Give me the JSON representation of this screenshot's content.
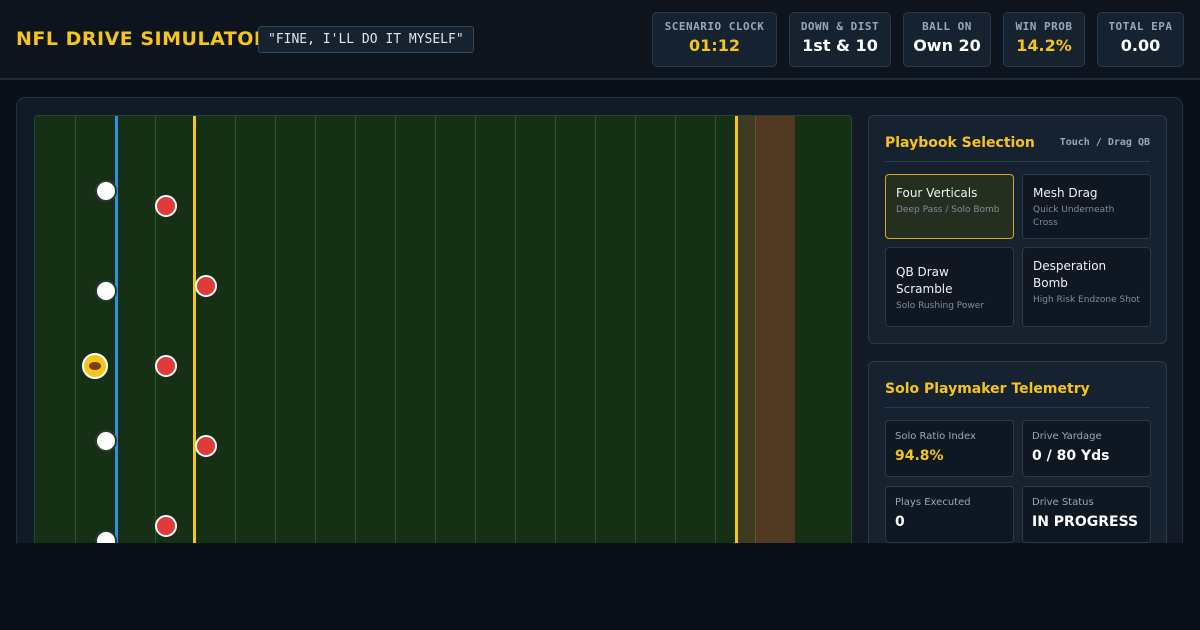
{
  "header": {
    "title": "NFL DRIVE SIMULATOR",
    "quote": "\"FINE, I'LL DO IT MYSELF\""
  },
  "stats": [
    {
      "label": "SCENARIO CLOCK",
      "value": "01:12",
      "accent": true
    },
    {
      "label": "DOWN & DIST",
      "value": "1st & 10",
      "accent": false
    },
    {
      "label": "BALL ON",
      "value": "Own 20",
      "accent": false
    },
    {
      "label": "WIN PROB",
      "value": "14.2%",
      "accent": true
    },
    {
      "label": "TOTAL EPA",
      "value": "0.00",
      "accent": false
    }
  ],
  "field": {
    "colors": {
      "turf": "#153014",
      "los": "#2f8fe0",
      "first_down": "#f5c518",
      "endzone": "#523a22",
      "offense": "#ffffff",
      "defense": "#e03a3a"
    }
  },
  "playbook": {
    "title": "Playbook Selection",
    "hint": "Touch / Drag QB",
    "plays": [
      {
        "name": "Four Verticals",
        "desc": "Deep Pass / Solo Bomb",
        "active": true
      },
      {
        "name": "Mesh Drag",
        "desc": "Quick Underneath Cross",
        "active": false
      },
      {
        "name": "QB Draw Scramble",
        "desc": "Solo Rushing Power",
        "active": false
      },
      {
        "name": "Desperation Bomb",
        "desc": "High Risk Endzone Shot",
        "active": false
      }
    ]
  },
  "telemetry": {
    "title": "Solo Playmaker Telemetry",
    "metrics": [
      {
        "label": "Solo Ratio Index",
        "value": "94.8%",
        "accent": true
      },
      {
        "label": "Drive Yardage",
        "value": "0 / 80 Yds",
        "accent": false
      },
      {
        "label": "Plays Executed",
        "value": "0",
        "accent": false
      },
      {
        "label": "Drive Status",
        "value": "IN PROGRESS",
        "accent": false
      }
    ]
  },
  "colors": {
    "accent": "#f5c518",
    "background": "#0a0f17",
    "panel": "#172231"
  }
}
